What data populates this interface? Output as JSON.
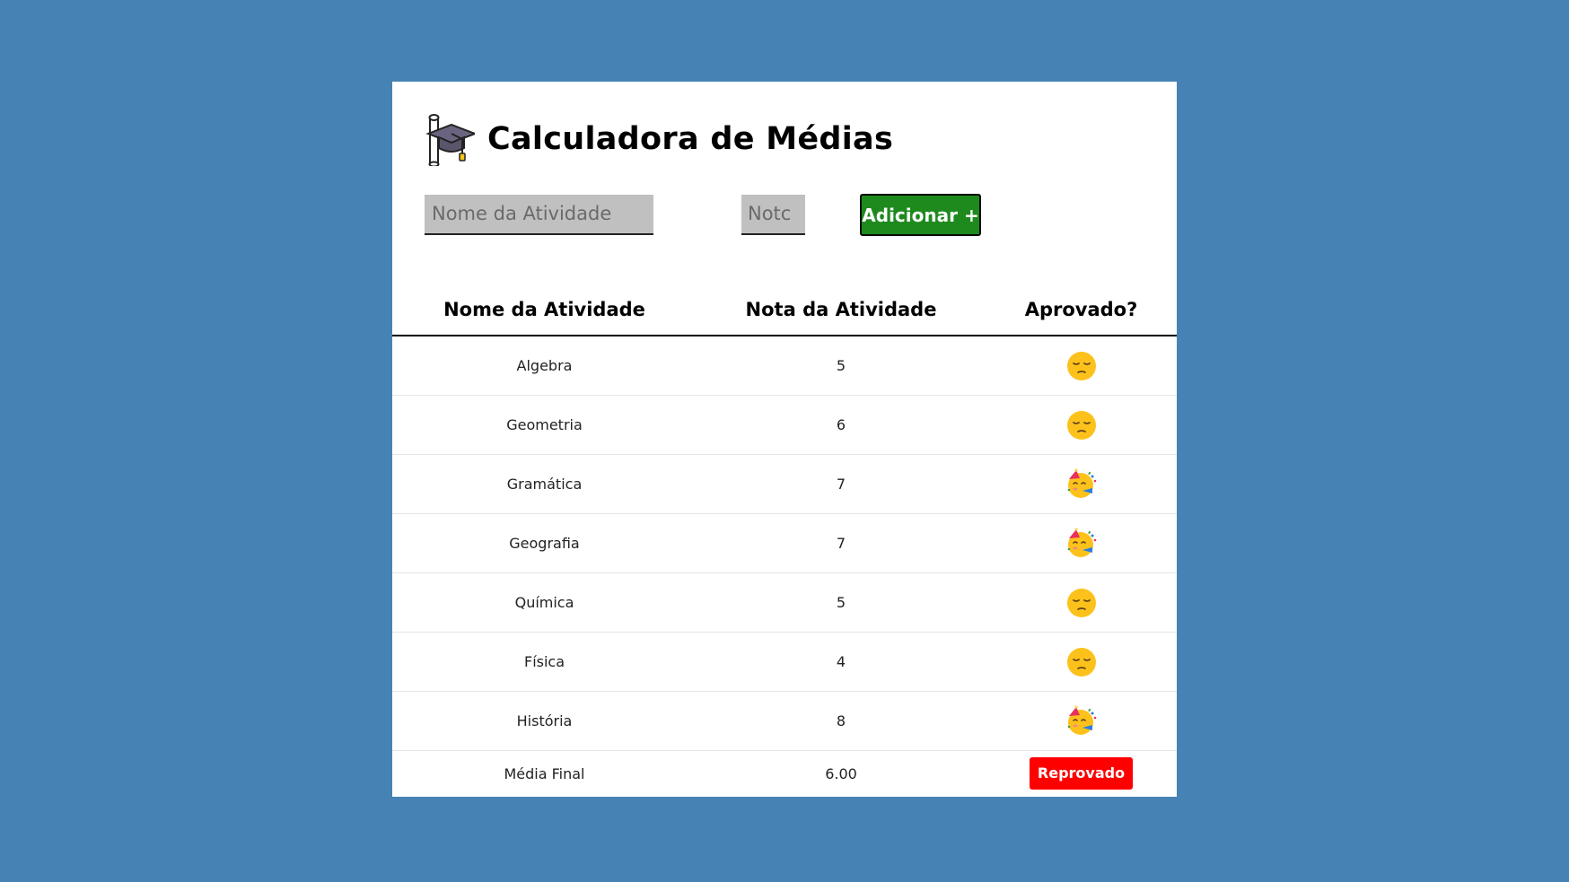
{
  "app": {
    "title": "Calculadora de Médias"
  },
  "form": {
    "name_placeholder": "Nome da Atividade",
    "nota_placeholder": "Nota",
    "nota_visible_text": "Notc",
    "add_button_label": "Adicionar +"
  },
  "table": {
    "headers": [
      "Nome da Atividade",
      "Nota da Atividade",
      "Aprovado?"
    ],
    "rows": [
      {
        "name": "Algebra",
        "nota": "5",
        "status_icon": "pensive-face-icon"
      },
      {
        "name": "Geometria",
        "nota": "6",
        "status_icon": "pensive-face-icon"
      },
      {
        "name": "Gramática",
        "nota": "7",
        "status_icon": "partying-face-icon"
      },
      {
        "name": "Geografia",
        "nota": "7",
        "status_icon": "partying-face-icon"
      },
      {
        "name": "Química",
        "nota": "5",
        "status_icon": "pensive-face-icon"
      },
      {
        "name": "Física",
        "nota": "4",
        "status_icon": "pensive-face-icon"
      },
      {
        "name": "História",
        "nota": "8",
        "status_icon": "partying-face-icon"
      }
    ],
    "final": {
      "label": "Média Final",
      "value": "6.00",
      "result": "Reprovado"
    }
  },
  "colors": {
    "background": "#4682b4",
    "card": "#ffffff",
    "add_button": "#1e8a1e",
    "reprovado_badge": "#ff0000",
    "input_background": "#c0c0c0"
  }
}
